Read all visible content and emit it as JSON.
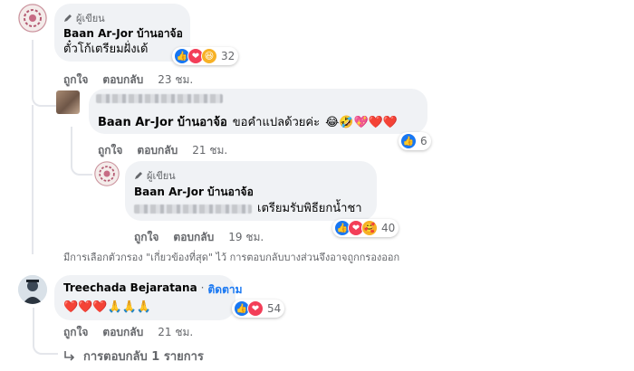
{
  "comments": [
    {
      "author_tag": "ผู้เขียน",
      "name": "Baan Ar-Jor บ้านอาจ้อ",
      "text": "ตั๋วโก้เตรียมฝั่งเด้",
      "like": "ถูกใจ",
      "reply": "ตอบกลับ",
      "time": "23 ชม.",
      "reaction_count": "32"
    },
    {
      "mention": "Baan Ar-Jor บ้านอาจ้อ",
      "text": "ขอคำแปลด้วยค่ะ",
      "emojis": "😂🤣💖❤️❤️",
      "like": "ถูกใจ",
      "reply": "ตอบกลับ",
      "time": "21 ชม.",
      "reaction_count": "6"
    },
    {
      "author_tag": "ผู้เขียน",
      "name": "Baan Ar-Jor บ้านอาจ้อ",
      "text": "เตรียมรับพิธียกน้ำชา",
      "like": "ถูกใจ",
      "reply": "ตอบกลับ",
      "time": "19 ชม.",
      "reaction_count": "40"
    },
    {
      "name": "Treechada Bejaratana",
      "follow": "ติดตาม",
      "emojis": "❤️❤️❤️🙏🙏🙏",
      "like": "ถูกใจ",
      "reply": "ตอบกลับ",
      "time": "21 ชม.",
      "reaction_count": "54"
    }
  ],
  "filter_notice": "มีการเลือกตัวกรอง \"เกี่ยวข้องที่สุด\" ไว้ การตอบกลับบางส่วนจึงอาจถูกกรองออก",
  "more_replies": "การตอบกลับ 1 รายการ",
  "colors": {
    "link": "#1877f2",
    "muted": "#65676b",
    "bubble": "#f0f2f5",
    "like_blue": "#1877f2",
    "love_red": "#f33e58",
    "haha_yellow": "#f7b125"
  },
  "icons": [
    "pencil-icon",
    "like-reaction-icon",
    "love-reaction-icon",
    "haha-reaction-icon",
    "care-reaction-icon",
    "reply-arrow-icon"
  ]
}
